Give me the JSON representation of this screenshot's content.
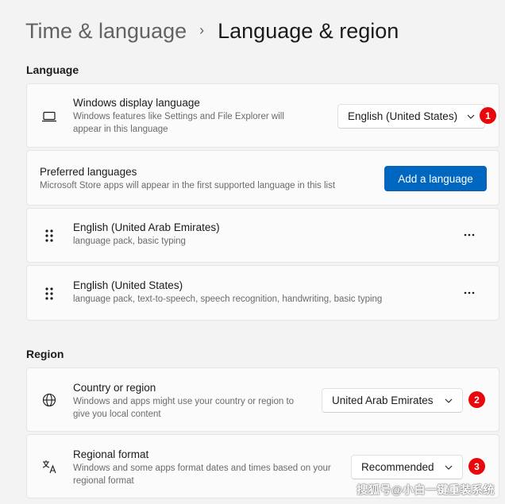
{
  "breadcrumb": {
    "parent": "Time & language",
    "separator": "›",
    "current": "Language & region"
  },
  "language_section": {
    "heading": "Language",
    "display_language": {
      "icon": "laptop-icon",
      "title": "Windows display language",
      "description": "Windows features like Settings and File Explorer will appear in this language",
      "selected": "English (United States)",
      "marker": "1"
    },
    "preferred": {
      "title": "Preferred languages",
      "description": "Microsoft Store apps will appear in the first supported language in this list",
      "add_button": "Add a language"
    },
    "languages": [
      {
        "name": "English (United Arab Emirates)",
        "features": "language pack, basic typing"
      },
      {
        "name": "English (United States)",
        "features": "language pack, text-to-speech, speech recognition, handwriting, basic typing"
      }
    ],
    "more_label": "···"
  },
  "region_section": {
    "heading": "Region",
    "country": {
      "icon": "globe-icon",
      "title": "Country or region",
      "description": "Windows and apps might use your country or region to give you local content",
      "selected": "United Arab Emirates",
      "marker": "2"
    },
    "format": {
      "icon": "regional-format-icon",
      "title": "Regional format",
      "description": "Windows and some apps format dates and times based on your regional format",
      "selected": "Recommended",
      "marker": "3"
    }
  },
  "watermark": "搜狐号@小白一键重装系统",
  "colors": {
    "accent": "#0067c0",
    "marker": "#e8070a",
    "background": "#f3f3f3",
    "card": "#fbfbfb"
  }
}
